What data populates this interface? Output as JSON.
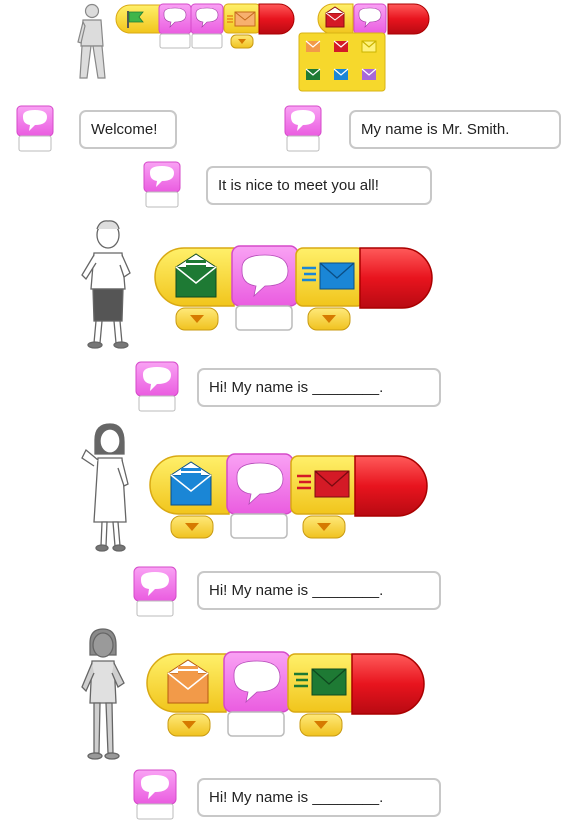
{
  "colors": {
    "yellow_block": "#f6d82c",
    "pink_block": "#f273ea",
    "red_end": "#e8141e",
    "arrow_orange": "#e47a12",
    "envelope_green": "#1e7a34",
    "envelope_blue": "#1a86d6",
    "envelope_red": "#d41a26",
    "envelope_orange": "#f29a49",
    "envelope_purple": "#a769d8",
    "flag_green": "#3fb54a"
  },
  "intro_line_1": "Welcome!",
  "intro_line_2": "My name is Mr. Smith.",
  "intro_line_3": "It is nice to meet you all!",
  "student_1_line": "Hi! My name is ________.",
  "student_2_line": "Hi! My name is ________.",
  "student_3_line": "Hi! My name is ________.",
  "icons": [
    "teacher-figure",
    "green-flag-icon",
    "speech-bubble-icon",
    "envelope-icon",
    "dropdown-arrow-icon",
    "end-block",
    "boy-figure",
    "girl-figure"
  ]
}
